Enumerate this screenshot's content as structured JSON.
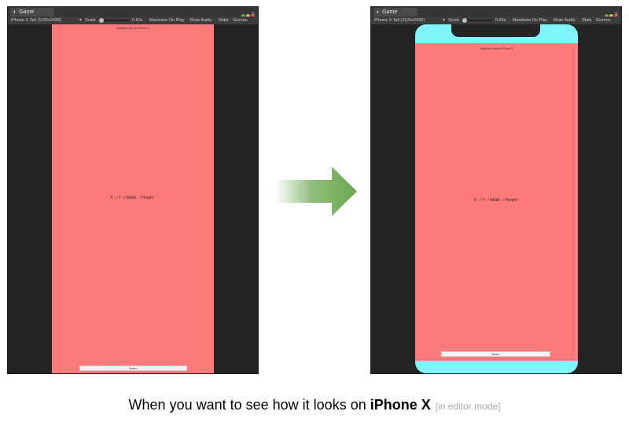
{
  "colors": {
    "screen_red": "#ff7b7b",
    "safe_area_cyan": "#7ff4fb",
    "arrow_green": "#6aa84f",
    "editor_dark": "#2a2a2a"
  },
  "editor": {
    "tab_icon": "unity-icon",
    "tab_title": "Game",
    "resolution": "iPhone X Tall (1125x2436)",
    "scale_label": "Scale",
    "scale_value": "0.63x",
    "maximize_on_play": "Maximize On Play",
    "mute_audio": "Mute Audio",
    "stats": "Stats",
    "gizmos": "Gizmos"
  },
  "left_screen": {
    "safe_area_title": "SafeArea Test for iPhone X",
    "coords_text": "X : / Y : / Width : / Height :",
    "button_label": "Button"
  },
  "right_screen": {
    "safe_area_title": "SafeArea Test for iPhone X",
    "coords_text": "X : / Y : / Width : / Height :",
    "button_label": "Button"
  },
  "caption": {
    "prefix": "When you want to see how it looks on ",
    "device": "iPhone X",
    "note": "[in editor mode]"
  }
}
